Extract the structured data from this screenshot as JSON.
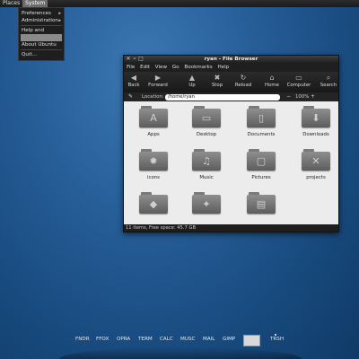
{
  "top_panel": {
    "menus": [
      "Places",
      "System"
    ],
    "active": "System"
  },
  "system_menu": {
    "items": [
      {
        "label": "Preferences",
        "submenu": true
      },
      {
        "label": "Administration",
        "submenu": true
      },
      {
        "label": "Help and Support",
        "submenu": false
      },
      {
        "label": "",
        "submenu": false,
        "highlighted": true
      },
      {
        "label": "About Ubuntu",
        "submenu": false
      },
      {
        "label": "Quit...",
        "submenu": false
      }
    ]
  },
  "window": {
    "title": "ryan - File Browser",
    "menubar": [
      "File",
      "Edit",
      "View",
      "Go",
      "Bookmarks",
      "Help"
    ],
    "toolbar": [
      {
        "label": "Back",
        "icon": "back-icon",
        "glyph": "◀"
      },
      {
        "label": "Forward",
        "icon": "forward-icon",
        "glyph": "▶"
      },
      {
        "label": "Up",
        "icon": "up-icon",
        "glyph": "▲"
      },
      {
        "label": "Stop",
        "icon": "stop-icon",
        "glyph": "✖"
      },
      {
        "label": "Reload",
        "icon": "reload-icon",
        "glyph": "↻"
      },
      {
        "label": "Home",
        "icon": "home-icon",
        "glyph": "⌂"
      },
      {
        "label": "Computer",
        "icon": "computer-icon",
        "glyph": "▭"
      },
      {
        "label": "Search",
        "icon": "search-icon",
        "glyph": "⌕"
      }
    ],
    "location_label": "Location:",
    "location_value": "/home/ryan",
    "zoom": "100%",
    "items": [
      {
        "name": "Apps",
        "icon": "apps-folder-icon",
        "glyph": "A"
      },
      {
        "name": "Desktop",
        "icon": "desktop-folder-icon",
        "glyph": "▭"
      },
      {
        "name": "Documents",
        "icon": "documents-folder-icon",
        "glyph": "▯"
      },
      {
        "name": "Downloads",
        "icon": "downloads-folder-icon",
        "glyph": "⬇"
      },
      {
        "name": "icons",
        "icon": "icons-folder-icon",
        "glyph": "✹"
      },
      {
        "name": "Music",
        "icon": "music-folder-icon",
        "glyph": "♫"
      },
      {
        "name": "Pictures",
        "icon": "pictures-folder-icon",
        "glyph": "▢"
      },
      {
        "name": "projects",
        "icon": "projects-folder-icon",
        "glyph": "✕"
      },
      {
        "name": "",
        "icon": "public-folder-icon",
        "glyph": "◆"
      },
      {
        "name": "",
        "icon": "templates-folder-icon",
        "glyph": "✦"
      },
      {
        "name": "",
        "icon": "videos-folder-icon",
        "glyph": "▤"
      }
    ],
    "status": "11 items, Free space: 45.7 GB"
  },
  "dock": {
    "items": [
      "FNDR",
      "FFOX",
      "OPRA",
      "TERM",
      "CALC",
      "MUSC",
      "MAIL",
      "GIMP",
      "",
      "TRSH"
    ]
  }
}
